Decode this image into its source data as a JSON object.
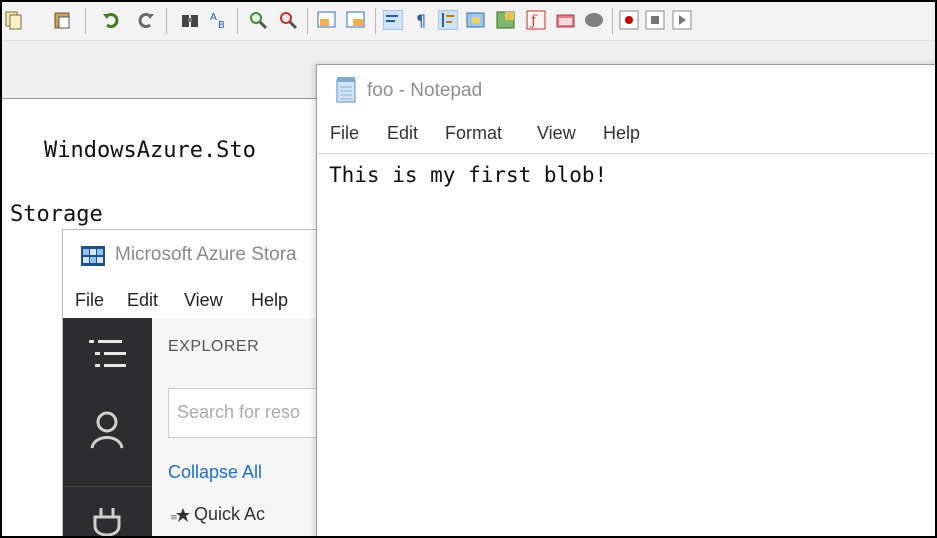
{
  "background_editor": {
    "line1": "WindowsAzure.Sto",
    "line2": "Storage"
  },
  "storage_explorer": {
    "title": "Microsoft Azure Stora",
    "menu": [
      "File",
      "Edit",
      "View",
      "Help"
    ],
    "explorer_header": "EXPLORER",
    "search_placeholder": "Search for reso",
    "collapse_all": "Collapse All",
    "quick_access": "Quick Ac"
  },
  "notepad": {
    "title": "foo - Notepad",
    "menu": [
      "File",
      "Edit",
      "Format",
      "View",
      "Help"
    ],
    "content": "This is my first blob!"
  },
  "colors": {
    "rail": "#2d2d30",
    "link": "#1f6fc5",
    "title_text": "#8f8f8f"
  }
}
